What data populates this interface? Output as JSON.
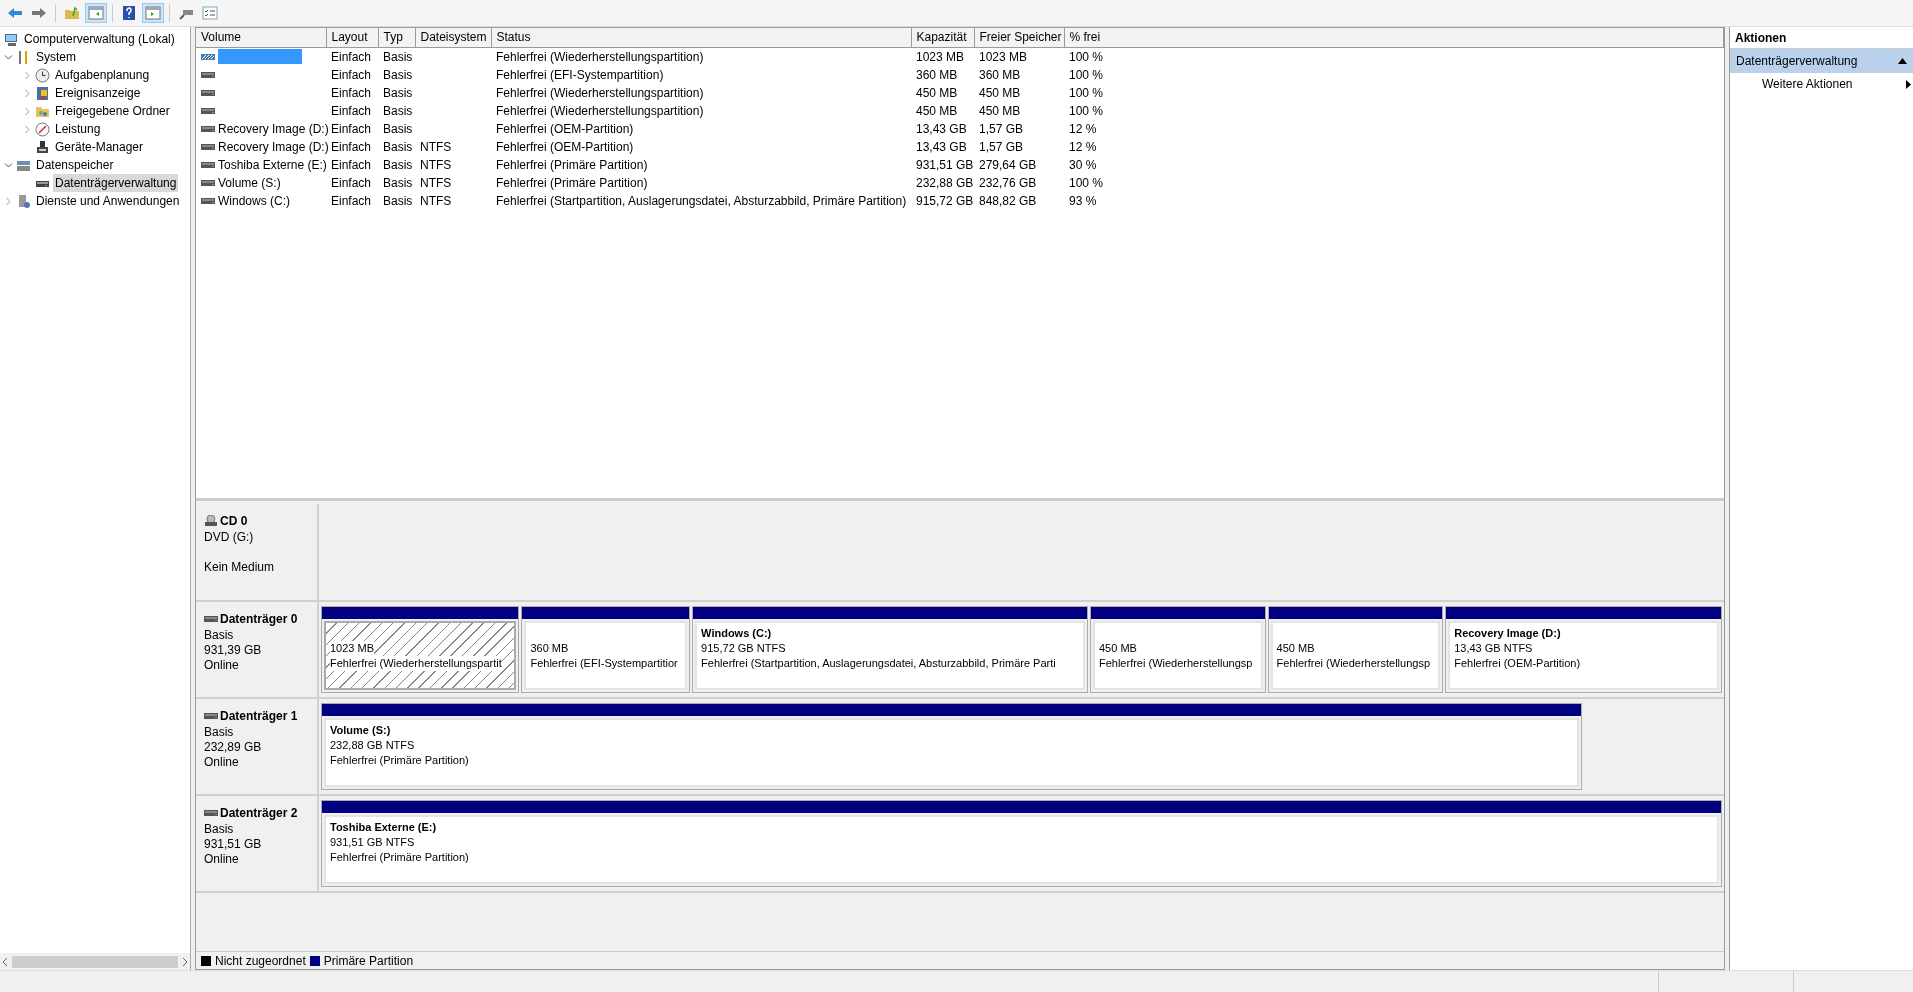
{
  "tree": [
    {
      "label": "Computerverwaltung (Lokal)",
      "kind": "computer",
      "selected": false,
      "children": [
        {
          "label": "System",
          "kind": "tools",
          "expanded": true,
          "selected": false,
          "children": [
            {
              "label": "Aufgabenplanung",
              "kind": "clock",
              "expanded": false,
              "selected": false
            },
            {
              "label": "Ereignisanzeige",
              "kind": "log",
              "expanded": false,
              "selected": false
            },
            {
              "label": "Freigegebene Ordner",
              "kind": "folder",
              "expanded": false,
              "selected": false
            },
            {
              "label": "Leistung",
              "kind": "gauge",
              "expanded": false,
              "selected": false
            },
            {
              "label": "Geräte-Manager",
              "kind": "device",
              "selected": false
            }
          ]
        },
        {
          "label": "Datenspeicher",
          "kind": "storage",
          "expanded": true,
          "selected": false,
          "children": [
            {
              "label": "Datenträgerverwaltung",
              "kind": "disk",
              "selected": true
            }
          ]
        },
        {
          "label": "Dienste und Anwendungen",
          "kind": "services",
          "expanded": false,
          "selected": false
        }
      ]
    }
  ],
  "table": {
    "columns": [
      "Volume",
      "Layout",
      "Typ",
      "Dateisystem",
      "Status",
      "Kapazität",
      "Freier Speicher",
      "% frei"
    ],
    "rows": [
      {
        "selected": true,
        "cells": [
          "",
          "Einfach",
          "Basis",
          "",
          "Fehlerfrei (Wiederherstellungspartition)",
          "1023 MB",
          "1023 MB",
          "100 %"
        ]
      },
      {
        "selected": false,
        "cells": [
          "",
          "Einfach",
          "Basis",
          "",
          "Fehlerfrei (EFI-Systempartition)",
          "360 MB",
          "360 MB",
          "100 %"
        ]
      },
      {
        "selected": false,
        "cells": [
          "",
          "Einfach",
          "Basis",
          "",
          "Fehlerfrei (Wiederherstellungspartition)",
          "450 MB",
          "450 MB",
          "100 %"
        ]
      },
      {
        "selected": false,
        "cells": [
          "",
          "Einfach",
          "Basis",
          "",
          "Fehlerfrei (Wiederherstellungspartition)",
          "450 MB",
          "450 MB",
          "100 %"
        ]
      },
      {
        "selected": false,
        "cells": [
          "Recovery Image (D:)",
          "Einfach",
          "Basis",
          "",
          "Fehlerfrei (OEM-Partition)",
          "13,43 GB",
          "1,57 GB",
          "12 %"
        ]
      },
      {
        "selected": false,
        "cells": [
          "Recovery Image (D:)",
          "Einfach",
          "Basis",
          "NTFS",
          "Fehlerfrei (OEM-Partition)",
          "13,43 GB",
          "1,57 GB",
          "12 %"
        ]
      },
      {
        "selected": false,
        "cells": [
          "Toshiba Externe (E:)",
          "Einfach",
          "Basis",
          "NTFS",
          "Fehlerfrei (Primäre Partition)",
          "931,51 GB",
          "279,64 GB",
          "30 %"
        ]
      },
      {
        "selected": false,
        "cells": [
          "Volume (S:)",
          "Einfach",
          "Basis",
          "NTFS",
          "Fehlerfrei (Primäre Partition)",
          "232,88 GB",
          "232,76 GB",
          "100 %"
        ]
      },
      {
        "selected": false,
        "cells": [
          "Windows (C:)",
          "Einfach",
          "Basis",
          "NTFS",
          "Fehlerfrei (Startpartition, Auslagerungsdatei, Absturzabbild, Primäre Partition)",
          "915,72 GB",
          "848,82 GB",
          "93 %"
        ]
      }
    ]
  },
  "disks": [
    {
      "kind": "cd",
      "name": "CD 0",
      "lines": [
        "DVD (G:)",
        "Kein Medium"
      ]
    },
    {
      "kind": "disk",
      "name": "Datenträger 0",
      "lines": [
        "Basis",
        "931,39 GB",
        "Online"
      ],
      "partitions": [
        {
          "selected": true,
          "size": "1023 MB",
          "status": "Fehlerfrei (Wiederherstellungspartit"
        },
        {
          "selected": false,
          "size": "360 MB",
          "status": "Fehlerfrei (EFI-Systempartitior"
        },
        {
          "selected": false,
          "name": "Windows  (C:)",
          "size": "915,72 GB NTFS",
          "status": "Fehlerfrei (Startpartition, Auslagerungsdatei, Absturzabbild, Primäre Parti"
        },
        {
          "selected": false,
          "size": "450 MB",
          "status": "Fehlerfrei (Wiederherstellungsp"
        },
        {
          "selected": false,
          "size": "450 MB",
          "status": "Fehlerfrei (Wiederherstellungsp"
        },
        {
          "selected": false,
          "name": "Recovery Image  (D:)",
          "size": "13,43 GB NTFS",
          "status": "Fehlerfrei (OEM-Partition)"
        }
      ]
    },
    {
      "kind": "disk",
      "name": "Datenträger 1",
      "lines": [
        "Basis",
        "232,89 GB",
        "Online"
      ],
      "partitions": [
        {
          "selected": false,
          "name": "Volume  (S:)",
          "size": "232,88 GB NTFS",
          "status": "Fehlerfrei (Primäre Partition)"
        }
      ]
    },
    {
      "kind": "disk",
      "name": "Datenträger 2",
      "lines": [
        "Basis",
        "931,51 GB",
        "Online"
      ],
      "partitions": [
        {
          "selected": false,
          "name": "Toshiba Externe  (E:)",
          "size": "931,51 GB NTFS",
          "status": "Fehlerfrei (Primäre Partition)"
        }
      ]
    }
  ],
  "legend": [
    {
      "label": "Nicht zugeordnet",
      "color": "#000000"
    },
    {
      "label": "Primäre Partition",
      "color": "#000080"
    }
  ],
  "actions": {
    "title": "Aktionen",
    "section": "Datenträgerverwaltung",
    "items": [
      "Weitere Aktionen"
    ]
  }
}
